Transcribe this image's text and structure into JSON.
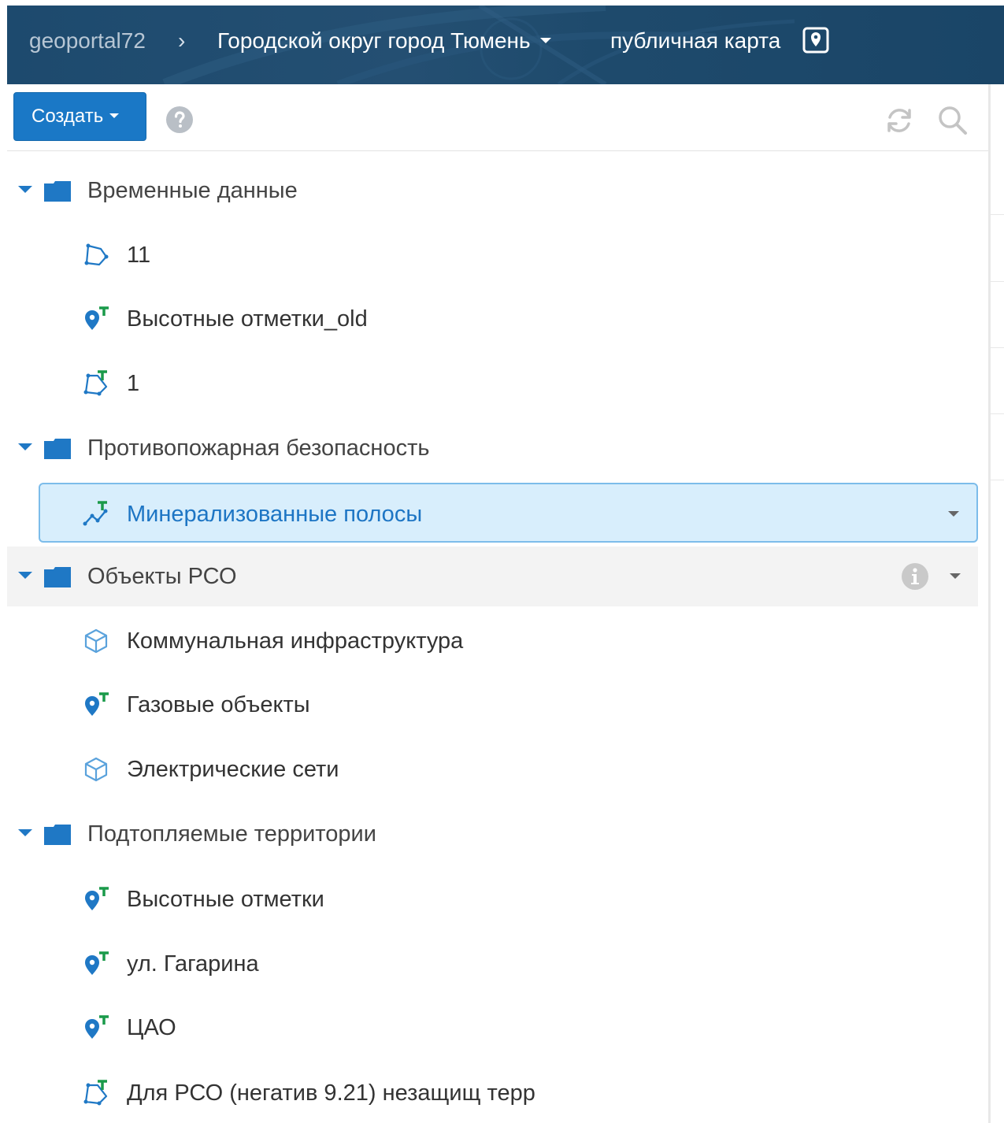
{
  "header": {
    "home": "geoportal72",
    "separator": "›",
    "organization": "Городской округ город Тюмень",
    "map_link": "публичная карта",
    "map_icon": "map-marker-square-icon"
  },
  "toolbar": {
    "create_label": "Создать",
    "help_icon": "question-circle-icon",
    "refresh_icon": "refresh-icon",
    "search_icon": "search-icon"
  },
  "tree": [
    {
      "type": "folder",
      "label": "Временные данные",
      "expanded": true
    },
    {
      "type": "layer",
      "label": "11",
      "icon": "polygon-icon"
    },
    {
      "type": "layer",
      "label": "Высотные отметки_old",
      "icon": "point-text-icon"
    },
    {
      "type": "layer",
      "label": "1",
      "icon": "polygon-text-icon"
    },
    {
      "type": "folder",
      "label": "Противопожарная безопасность",
      "expanded": true
    },
    {
      "type": "layer",
      "label": "Минерализованные полосы",
      "icon": "line-text-icon",
      "selected": true
    },
    {
      "type": "folder",
      "label": "Объекты РСО",
      "expanded": true,
      "hover": true
    },
    {
      "type": "layer",
      "label": "Коммунальная инфраструктура",
      "icon": "cube-icon"
    },
    {
      "type": "layer",
      "label": "Газовые объекты",
      "icon": "point-text-icon"
    },
    {
      "type": "layer",
      "label": "Электрические сети",
      "icon": "cube-icon"
    },
    {
      "type": "folder",
      "label": "Подтопляемые территории",
      "expanded": true
    },
    {
      "type": "layer",
      "label": "Высотные отметки",
      "icon": "point-text-icon"
    },
    {
      "type": "layer",
      "label": "ул. Гагарина",
      "icon": "point-text-icon"
    },
    {
      "type": "layer",
      "label": "ЦАО",
      "icon": "point-text-icon"
    },
    {
      "type": "layer",
      "label": "Для РСО (негатив 9.21) незащищ терр",
      "icon": "polygon-text-icon"
    }
  ],
  "colors": {
    "header_bg": "#1f4b6e",
    "accent": "#1a78c6",
    "selected_bg": "#d8eefc",
    "selected_border": "#7cbcea",
    "icon_blue": "#1f78c5"
  }
}
